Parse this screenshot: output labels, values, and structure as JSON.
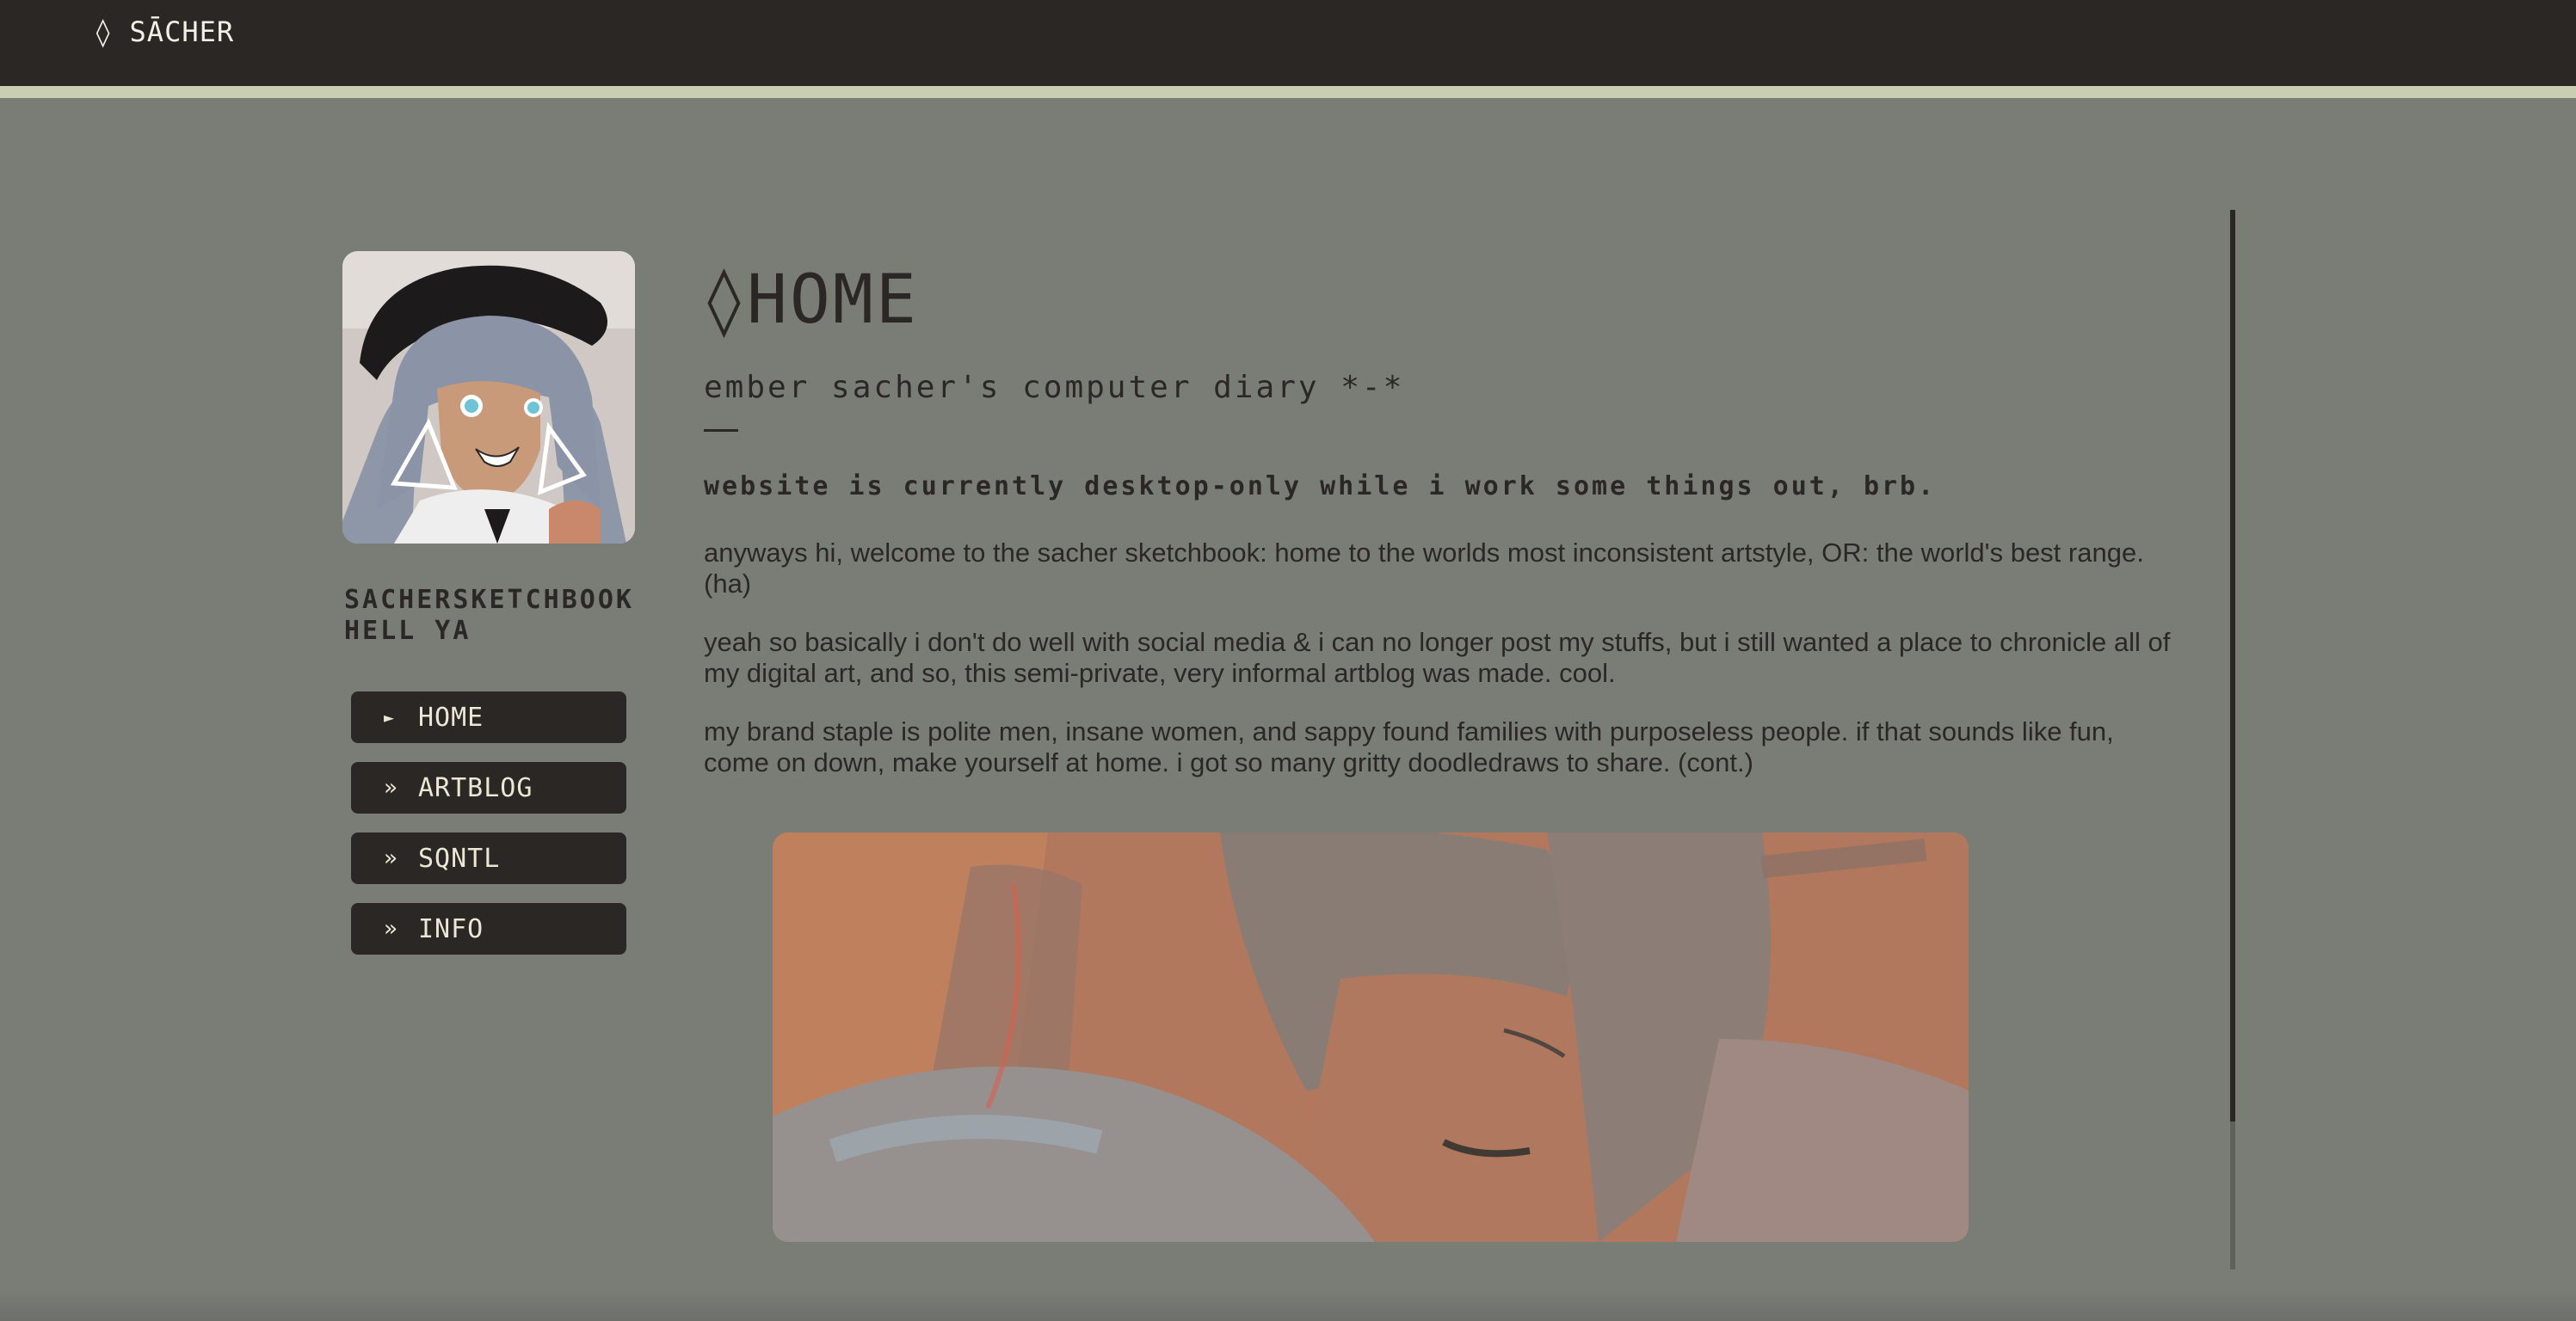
{
  "header": {
    "brand": "◊ SĀCHER"
  },
  "sidebar": {
    "site_name": "SACHERSKETCHBOOK HELL YA",
    "nav": [
      {
        "arrow": "►",
        "label": "HOME"
      },
      {
        "arrow": "»",
        "label": "ARTBLOG"
      },
      {
        "arrow": "»",
        "label": "SQNTL"
      },
      {
        "arrow": "»",
        "label": "INFO"
      }
    ]
  },
  "main": {
    "title": "◊HOME",
    "subtitle": "ember sacher's computer diary *-*",
    "notice": "website is currently desktop-only while i work some things out, brb.",
    "paragraphs": [
      "anyways hi, welcome to the sacher sketchbook: home to the worlds most inconsistent artstyle, OR: the world's best range. (ha)",
      "yeah so basically i don't do well with social media & i can no longer post my stuffs, but i still wanted a place to chronicle all of my digital art, and so, this semi-private, very informal artblog was made. cool.",
      "my brand staple is polite men, insane women, and sappy found families with purposeless people. if that sounds like fun, come on down, make yourself at home. i got so many gritty doodledraws to share. (cont.)"
    ]
  },
  "colors": {
    "background": "#7a7d76",
    "header": "#2b2725",
    "accent_stripe": "#c9cdb2",
    "text": "#2b2725",
    "button_text": "#ece6d5"
  }
}
